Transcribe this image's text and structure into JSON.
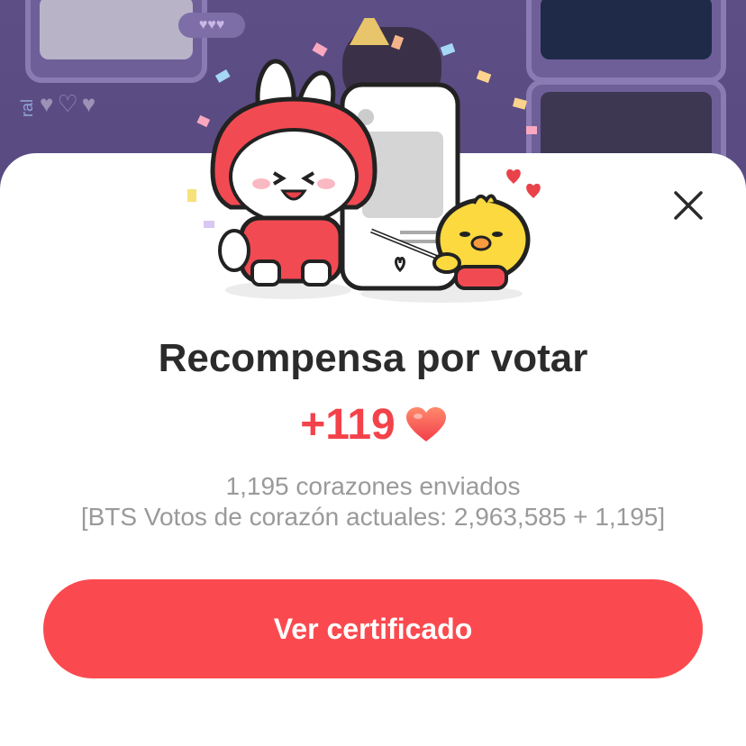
{
  "modal": {
    "title": "Recompensa por votar",
    "reward_amount": "+119",
    "hearts_sent": "1,195 corazones enviados",
    "vote_status": "[BTS Votos de corazón actuales: 2,963,585 + 1,195]",
    "cta_label": "Ver certificado",
    "close_icon": "close-icon",
    "reward_icon": "heart-icon"
  },
  "background": {
    "pill_text": "♥♥♥",
    "side_text": "ral"
  },
  "colors": {
    "accent": "#fb4a4f",
    "reward_text": "#f4424a",
    "title_text": "#2b2b2b",
    "muted_text": "#9a9a9a",
    "overlay": "#5d4e86"
  }
}
